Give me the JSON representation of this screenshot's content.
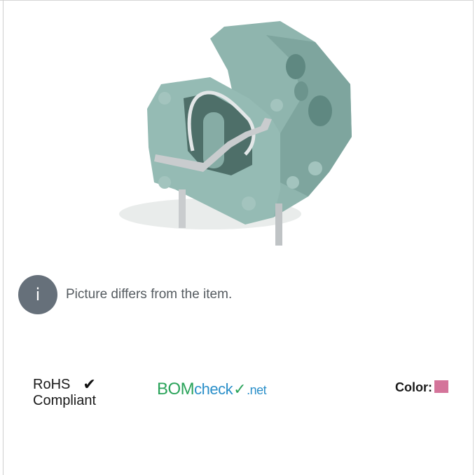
{
  "info": {
    "badge": "i",
    "text": "Picture differs from the item."
  },
  "rohs": {
    "line1": "RoHS",
    "check": "✔",
    "line2": "Compliant"
  },
  "bomcheck": {
    "part1": "BOM",
    "part2": "check",
    "part3": "✓",
    "part4": ".net"
  },
  "color": {
    "label": "Color:",
    "swatch": "#d4749a"
  },
  "colors": {
    "body": "#8fb5ae",
    "body_dark": "#6f9a93",
    "metal": "#c9ccce"
  }
}
